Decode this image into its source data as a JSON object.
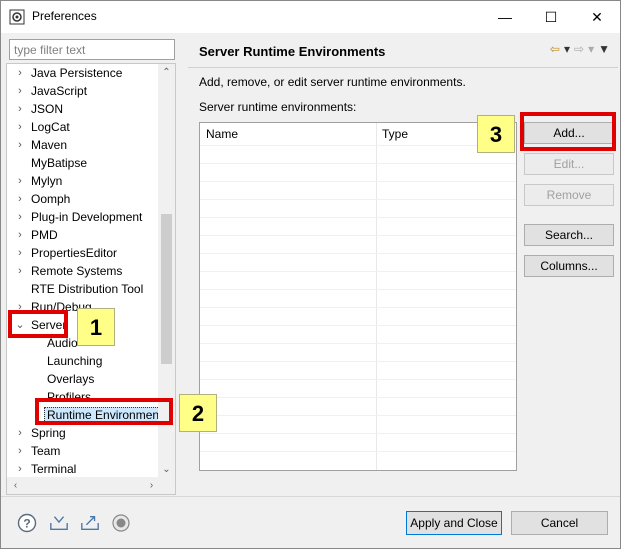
{
  "window": {
    "title": "Preferences",
    "controls": {
      "minimize": "—",
      "maximize": "☐",
      "close": "✕"
    }
  },
  "filter": {
    "placeholder": "type filter text",
    "value": ""
  },
  "tree": {
    "items": [
      {
        "label": "Java Persistence",
        "expandable": true
      },
      {
        "label": "JavaScript",
        "expandable": true
      },
      {
        "label": "JSON",
        "expandable": true
      },
      {
        "label": "LogCat",
        "expandable": true
      },
      {
        "label": "Maven",
        "expandable": true
      },
      {
        "label": "MyBatipse",
        "expandable": false
      },
      {
        "label": "Mylyn",
        "expandable": true
      },
      {
        "label": "Oomph",
        "expandable": true
      },
      {
        "label": "Plug-in Development",
        "expandable": true
      },
      {
        "label": "PMD",
        "expandable": true
      },
      {
        "label": "PropertiesEditor",
        "expandable": true
      },
      {
        "label": "Remote Systems",
        "expandable": true
      },
      {
        "label": "RTE Distribution Tool",
        "expandable": false
      },
      {
        "label": "Run/Debug",
        "expandable": true
      },
      {
        "label": "Server",
        "expandable": true,
        "expanded": true
      },
      {
        "label": "Audio",
        "child": true
      },
      {
        "label": "Launching",
        "child": true
      },
      {
        "label": "Overlays",
        "child": true
      },
      {
        "label": "Profilers",
        "child": true
      },
      {
        "label": "Runtime Environmen",
        "child": true,
        "selected": true
      },
      {
        "label": "Spring",
        "expandable": true
      },
      {
        "label": "Team",
        "expandable": true
      },
      {
        "label": "Terminal",
        "expandable": true
      }
    ]
  },
  "page": {
    "title": "Server Runtime Environments",
    "description": "Add, remove, or edit server runtime environments.",
    "list_label": "Server runtime environments:",
    "columns": [
      "Name",
      "Type"
    ]
  },
  "buttons": {
    "add": "Add...",
    "edit": "Edit...",
    "remove": "Remove",
    "search": "Search...",
    "columns": "Columns..."
  },
  "footer": {
    "apply_close": "Apply and Close",
    "cancel": "Cancel"
  },
  "annotations": {
    "step1": "1",
    "step2": "2",
    "step3": "3",
    "highlight_color": "#e00000",
    "badge_color": "#ffff88"
  }
}
